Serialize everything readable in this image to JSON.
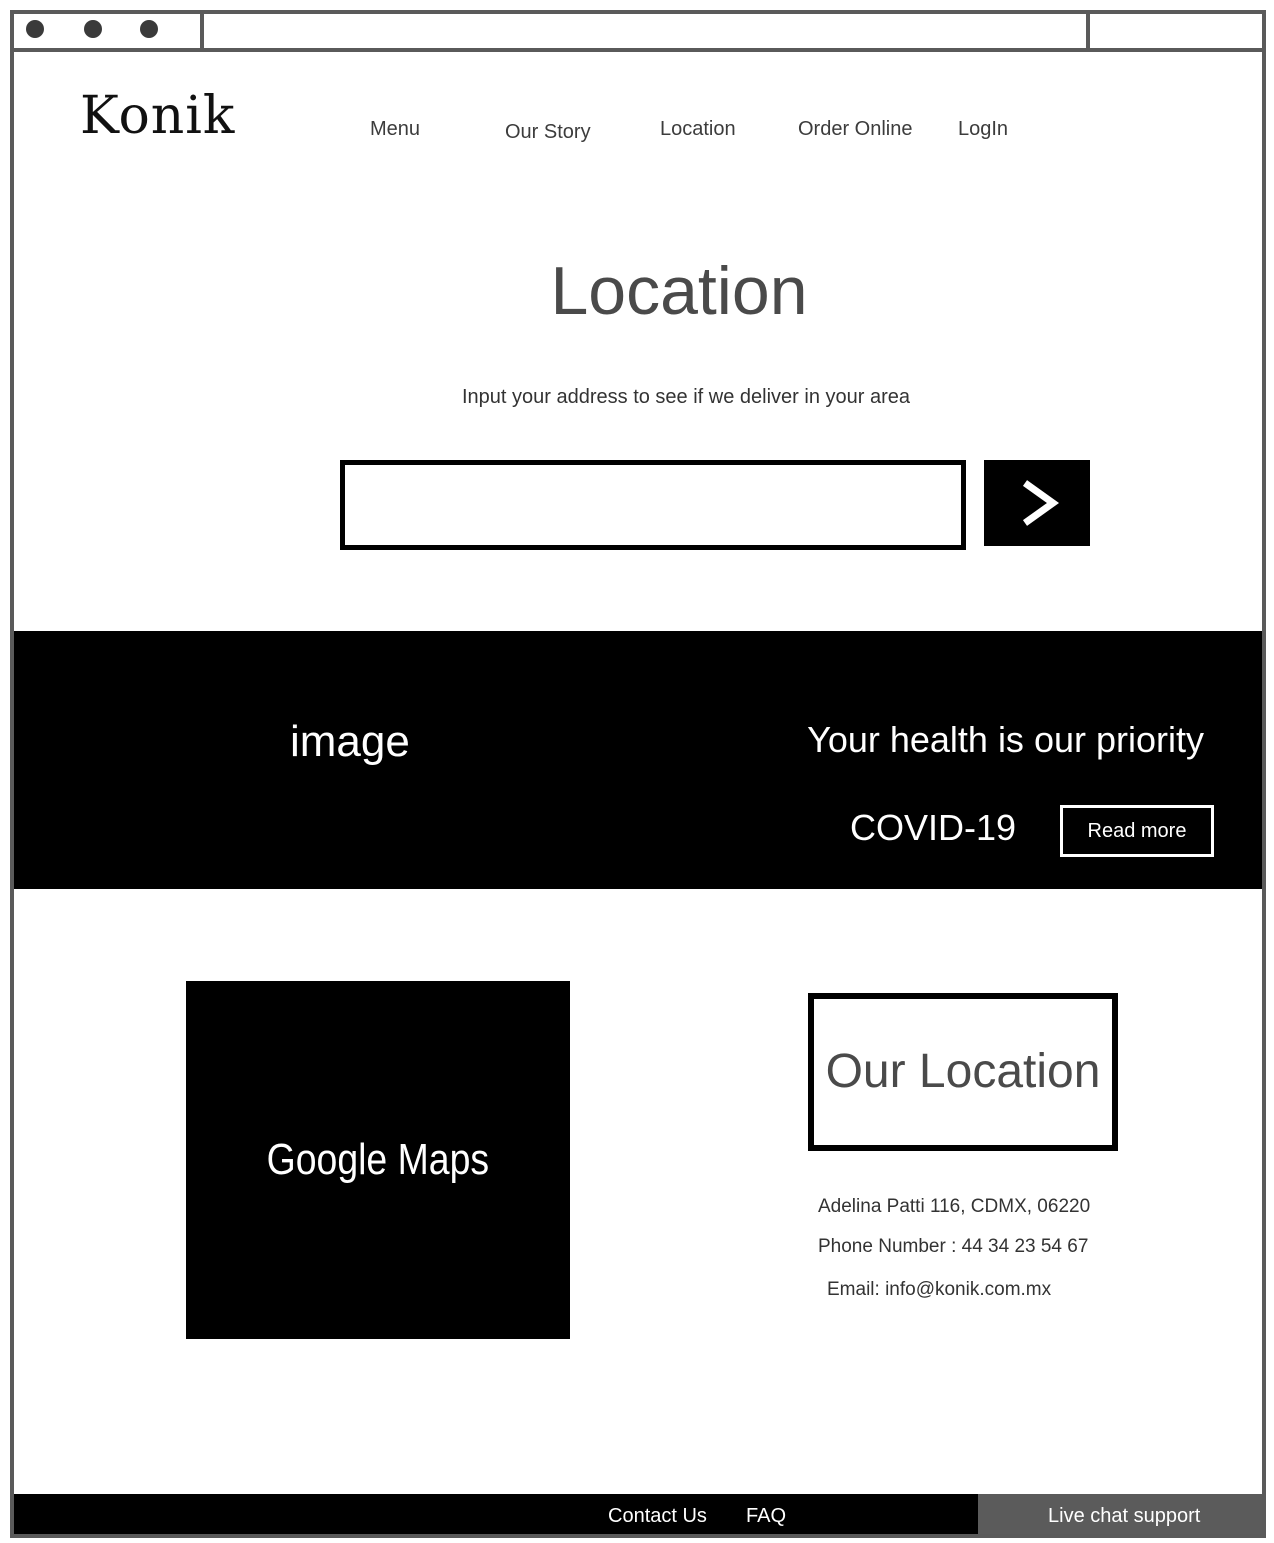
{
  "header": {
    "logo": "Konik",
    "nav": [
      "Menu",
      "Our Story",
      "Location",
      "Order Online",
      "LogIn"
    ]
  },
  "hero": {
    "title": "Location",
    "subtitle": "Input your address to see if we deliver in your area",
    "address_input_value": "",
    "submit_icon": "chevron-right-icon"
  },
  "banner": {
    "image_label": "image",
    "heading": "Your health is our priority",
    "covid_label": "COVID-19",
    "read_more_label": "Read more"
  },
  "map": {
    "label": "Google Maps"
  },
  "location": {
    "heading": "Our Location",
    "address": "Adelina Patti 116, CDMX, 06220",
    "phone": "Phone Number : 44 34 23 54 67",
    "email": "Email:  info@konik.com.mx"
  },
  "footer": {
    "contact_label": "Contact Us",
    "faq_label": "FAQ",
    "live_chat_label": "Live chat support"
  },
  "colors": {
    "background": "#ffffff",
    "primary_dark": "#000000",
    "frame": "#5a5a5a",
    "live_chat_bg": "#5b5b5b",
    "heading_gray": "#4a4a4a"
  }
}
